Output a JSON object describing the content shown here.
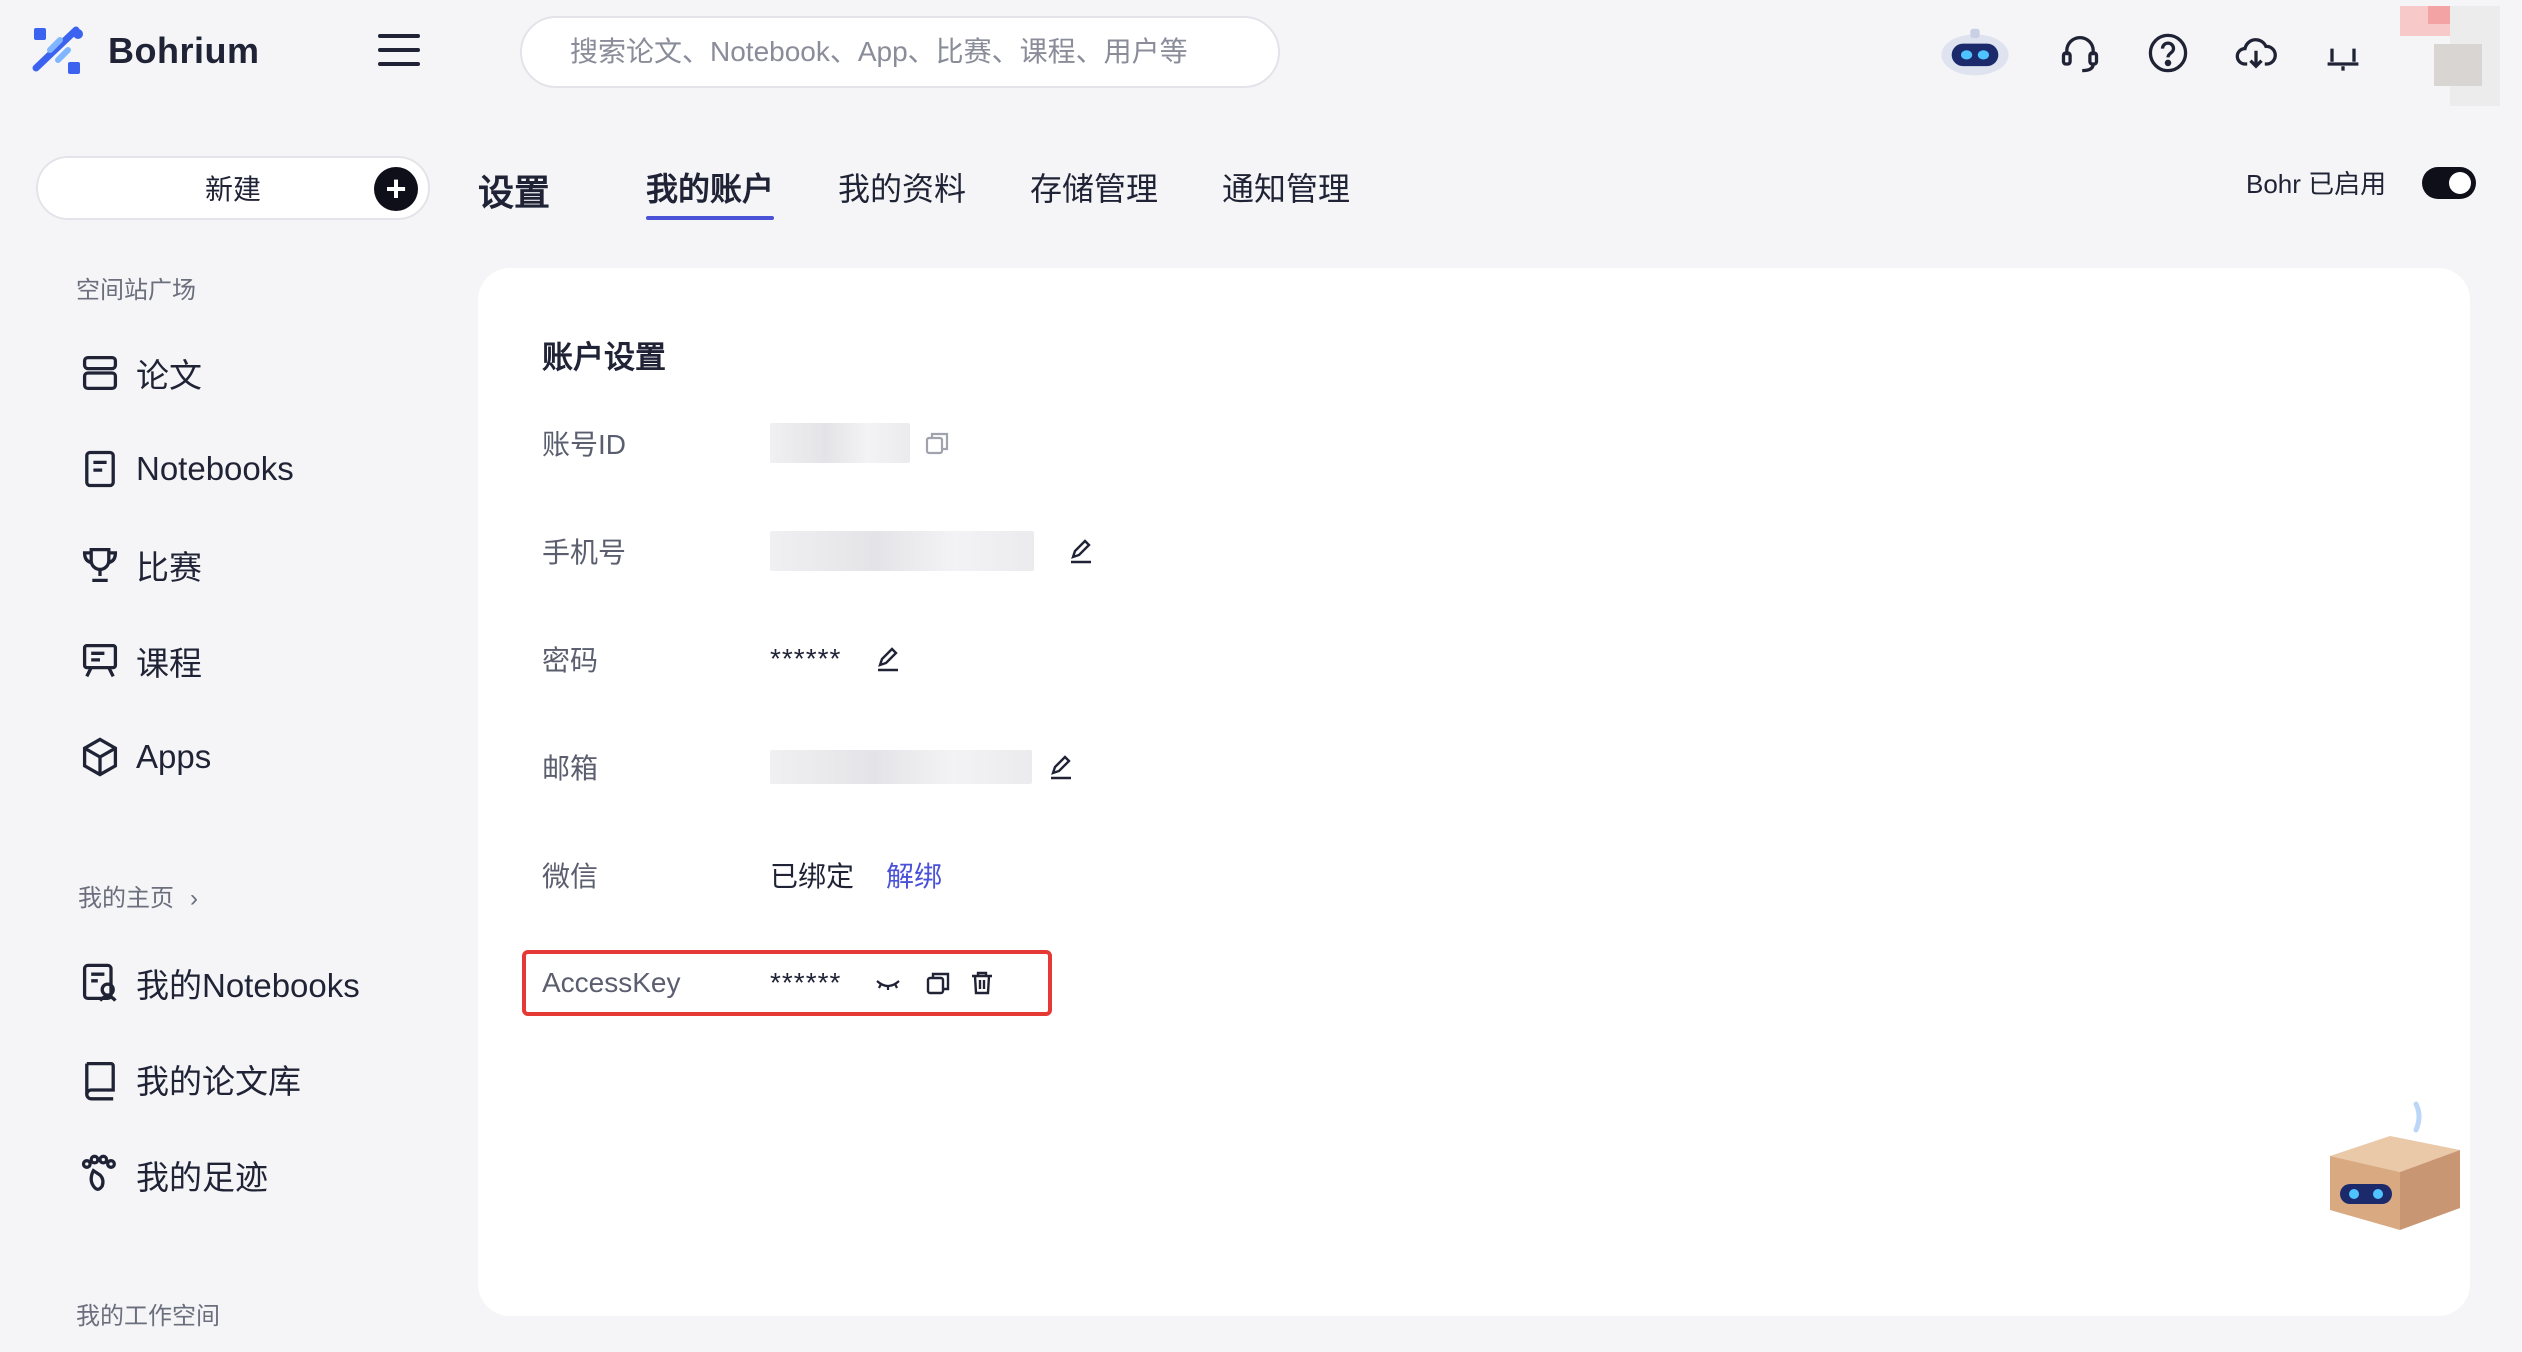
{
  "app": {
    "name": "Bohrium"
  },
  "search": {
    "placeholder": "搜索论文、Notebook、App、比赛、课程、用户等"
  },
  "sidebar": {
    "new_label": "新建",
    "section_station": "空间站广场",
    "station_items": [
      {
        "label": "论文",
        "icon": "paper-icon"
      },
      {
        "label": "Notebooks",
        "icon": "notebook-icon"
      },
      {
        "label": "比赛",
        "icon": "trophy-icon"
      },
      {
        "label": "课程",
        "icon": "course-icon"
      },
      {
        "label": "Apps",
        "icon": "cube-icon"
      }
    ],
    "section_home": "我的主页",
    "home_items": [
      {
        "label": "我的Notebooks",
        "icon": "my-notebook-icon"
      },
      {
        "label": "我的论文库",
        "icon": "book-icon"
      },
      {
        "label": "我的足迹",
        "icon": "footprint-icon"
      }
    ],
    "section_workspace": "我的工作空间"
  },
  "tabs": {
    "title": "设置",
    "items": [
      "我的账户",
      "我的资料",
      "存储管理",
      "通知管理"
    ],
    "active": "我的账户"
  },
  "bohr_toggle": {
    "label": "Bohr 已启用",
    "on": true
  },
  "account": {
    "title": "账户设置",
    "rows": {
      "id_label": "账号ID",
      "phone_label": "手机号",
      "password_label": "密码",
      "password_value": "******",
      "email_label": "邮箱",
      "wechat_label": "微信",
      "wechat_status": "已绑定",
      "wechat_unbind": "解绑",
      "accesskey_label": "AccessKey",
      "accesskey_value": "******"
    }
  },
  "colors": {
    "accent": "#4a52d8",
    "highlight": "#e53935",
    "background": "#f5f5f7"
  }
}
